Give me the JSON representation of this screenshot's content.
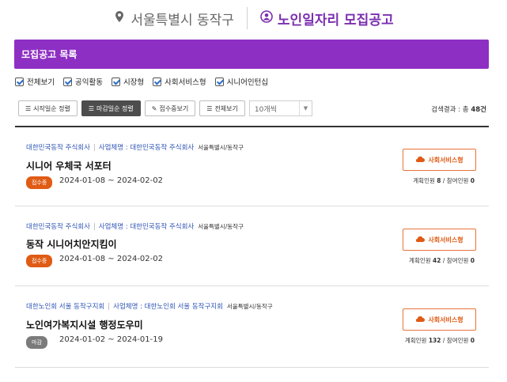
{
  "header": {
    "location": "서울특별시 동작구",
    "title": "노인일자리 모집공고"
  },
  "list": {
    "heading": "모집공고 목록"
  },
  "filters": [
    {
      "label": "전체보기",
      "checked": true
    },
    {
      "label": "공익활동",
      "checked": true
    },
    {
      "label": "시장형",
      "checked": true
    },
    {
      "label": "사회서비스형",
      "checked": true
    },
    {
      "label": "시니어인턴십",
      "checked": true
    }
  ],
  "toolbar": {
    "sort_start": "시작일순 정렬",
    "sort_end": "마감일순 정렬",
    "receiving": "접수중보기",
    "view_all": "전체보기",
    "page_size": "10개씩",
    "result_label": "검색결과 : 총",
    "result_count": "48",
    "result_unit": "건"
  },
  "posts": [
    {
      "company": "대한민국동작 주식회사",
      "business": "사업체명 : 대한민국동작 주식회사",
      "area": "서울특별시/동작구",
      "title": "시니어 우체국 서포터",
      "status": "접수중",
      "dates": "2024-01-08 ~ 2024-02-02",
      "type": "사회서비스형",
      "planned_label": "계획인원",
      "planned": "8",
      "joined_label": "참여인원",
      "joined": "0"
    },
    {
      "company": "대한민국동작 주식회사",
      "business": "사업체명 : 대한민국동작 주식회사",
      "area": "서울특별시/동작구",
      "title": "동작 시니어치안지킴이",
      "status": "접수중",
      "dates": "2024-01-08 ~ 2024-02-02",
      "type": "사회서비스형",
      "planned_label": "계획인원",
      "planned": "42",
      "joined_label": "참여인원",
      "joined": "0"
    },
    {
      "company": "대한노인회 서울 동작구지회",
      "business": "사업체명 : 대한노인회 서울 동작구지회",
      "area": "서울특별시/동작구",
      "title": "노인여가복지시설 행정도우미",
      "status": "마감",
      "dates": "2024-01-02 ~ 2024-01-19",
      "type": "사회서비스형",
      "planned_label": "계획인원",
      "planned": "132",
      "joined_label": "참여인원",
      "joined": "0"
    }
  ],
  "colors": {
    "accent_purple": "#8e2fc4",
    "title_purple": "#7b2fb0",
    "orange": "#e05b14",
    "link_blue": "#2f55b5"
  }
}
